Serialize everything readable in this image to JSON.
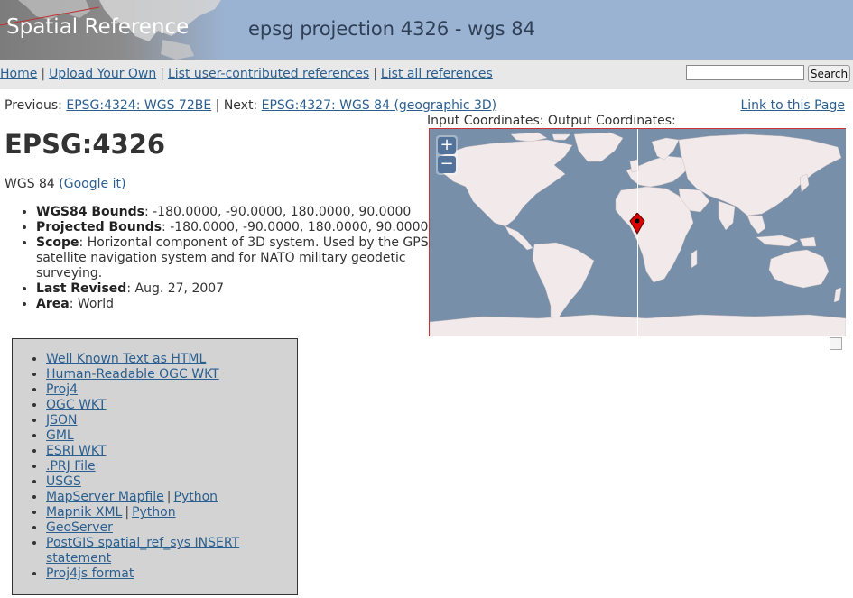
{
  "header": {
    "logo_text": "Spatial Reference",
    "title": "epsg projection 4326 - wgs 84",
    "colors": {
      "banner": "#9bb3d3",
      "link": "#2b5f8f",
      "nav_bg": "#e8e8e8",
      "box_bg": "#d3d3d3"
    }
  },
  "nav": {
    "links": [
      "Home",
      "Upload Your Own",
      "List user-contributed references",
      "List all references"
    ],
    "separator": "|",
    "search_placeholder": "",
    "search_button": "Search"
  },
  "prevnext": {
    "prev_label": "Previous:",
    "prev_link": "EPSG:4324: WGS 72BE",
    "separator": "|",
    "next_label": "Next:",
    "next_link": "EPSG:4327: WGS 84 (geographic 3D)",
    "permalink": "Link to this Page"
  },
  "coords": {
    "input_label": "Input Coordinates:",
    "output_label": "Output Coordinates:"
  },
  "reference": {
    "code": "EPSG:4326",
    "name": "WGS 84",
    "google_link": "(Google it)",
    "properties": [
      {
        "key": "WGS84 Bounds",
        "value": ": -180.0000, -90.0000, 180.0000, 90.0000"
      },
      {
        "key": "Projected Bounds",
        "value": ": -180.0000, -90.0000, 180.0000, 90.0000"
      },
      {
        "key": "Scope",
        "value": ": Horizontal component of 3D system. Used by the GPS satellite navigation system and for NATO military geodetic surveying."
      },
      {
        "key": "Last Revised",
        "value": ": Aug. 27, 2007"
      },
      {
        "key": "Area",
        "value": ": World"
      }
    ]
  },
  "map": {
    "zoom_in": "+",
    "zoom_out": "−",
    "colors": {
      "ocean": "#778fa8",
      "land": "#f1e9ea",
      "marker": "#dd0000"
    }
  },
  "formats": {
    "items": [
      [
        "Well Known Text as HTML"
      ],
      [
        "Human-Readable OGC WKT"
      ],
      [
        "Proj4"
      ],
      [
        "OGC WKT"
      ],
      [
        "JSON"
      ],
      [
        "GML"
      ],
      [
        "ESRI WKT"
      ],
      [
        ".PRJ File"
      ],
      [
        "USGS"
      ],
      [
        "MapServer Mapfile",
        "Python"
      ],
      [
        "Mapnik XML",
        "Python"
      ],
      [
        "GeoServer"
      ],
      [
        "PostGIS spatial_ref_sys INSERT statement"
      ],
      [
        "Proj4js format"
      ]
    ],
    "separator": "|"
  }
}
